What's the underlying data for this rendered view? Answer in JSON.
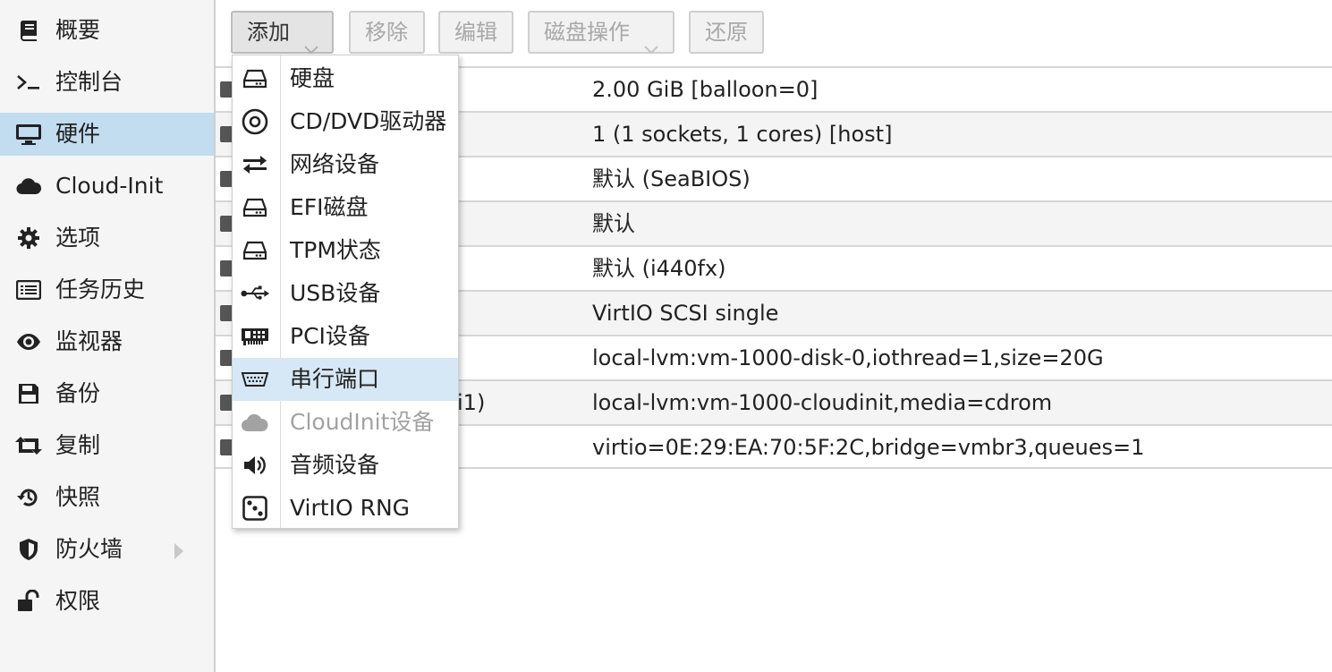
{
  "sidebar": {
    "items": [
      {
        "label": "概要",
        "icon": "book-icon"
      },
      {
        "label": "控制台",
        "icon": "terminal-icon"
      },
      {
        "label": "硬件",
        "icon": "monitor-icon",
        "active": true
      },
      {
        "label": "Cloud-Init",
        "icon": "cloud-icon"
      },
      {
        "label": "选项",
        "icon": "gear-icon"
      },
      {
        "label": "任务历史",
        "icon": "list-icon"
      },
      {
        "label": "监视器",
        "icon": "eye-icon"
      },
      {
        "label": "备份",
        "icon": "floppy-icon"
      },
      {
        "label": "复制",
        "icon": "retweet-icon"
      },
      {
        "label": "快照",
        "icon": "history-icon"
      },
      {
        "label": "防火墙",
        "icon": "shield-icon",
        "expandable": true
      },
      {
        "label": "权限",
        "icon": "unlock-icon"
      }
    ]
  },
  "toolbar": {
    "add_label": "添加",
    "remove_label": "移除",
    "edit_label": "编辑",
    "disk_action_label": "磁盘操作",
    "revert_label": "还原"
  },
  "hardware_table": {
    "rows": [
      {
        "name": "",
        "value": "2.00 GiB [balloon=0]"
      },
      {
        "name": "",
        "value": "1 (1 sockets, 1 cores) [host]"
      },
      {
        "name": "",
        "value": "默认 (SeaBIOS)"
      },
      {
        "name": "",
        "value": "默认"
      },
      {
        "name": "",
        "value": "默认 (i440fx)"
      },
      {
        "name": "",
        "value": "VirtIO SCSI single"
      },
      {
        "name": "",
        "value": "local-lvm:vm-1000-disk-0,iothread=1,size=20G"
      },
      {
        "name": "i1)",
        "value": "local-lvm:vm-1000-cloudinit,media=cdrom"
      },
      {
        "name": "",
        "value": "virtio=0E:29:EA:70:5F:2C,bridge=vmbr3,queues=1"
      }
    ]
  },
  "add_menu": {
    "items": [
      {
        "label": "硬盘",
        "icon": "hdd-icon"
      },
      {
        "label": "CD/DVD驱动器",
        "icon": "disc-icon"
      },
      {
        "label": "网络设备",
        "icon": "exchange-icon"
      },
      {
        "label": "EFI磁盘",
        "icon": "hdd-icon"
      },
      {
        "label": "TPM状态",
        "icon": "hdd-icon"
      },
      {
        "label": "USB设备",
        "icon": "usb-icon"
      },
      {
        "label": "PCI设备",
        "icon": "pci-card-icon"
      },
      {
        "label": "串行端口",
        "icon": "serial-port-icon",
        "hover": true
      },
      {
        "label": "CloudInit设备",
        "icon": "cloud-icon",
        "disabled": true
      },
      {
        "label": "音频设备",
        "icon": "volume-icon"
      },
      {
        "label": "VirtIO RNG",
        "icon": "dice-icon"
      }
    ]
  },
  "colors": {
    "sidebar_bg": "#f5f5f5",
    "active_item_bg": "#c2dcf0",
    "menu_hover_bg": "#d6e7f5",
    "disabled_text": "#a2a2a2",
    "alt_row_bg": "#f4f4f4"
  }
}
